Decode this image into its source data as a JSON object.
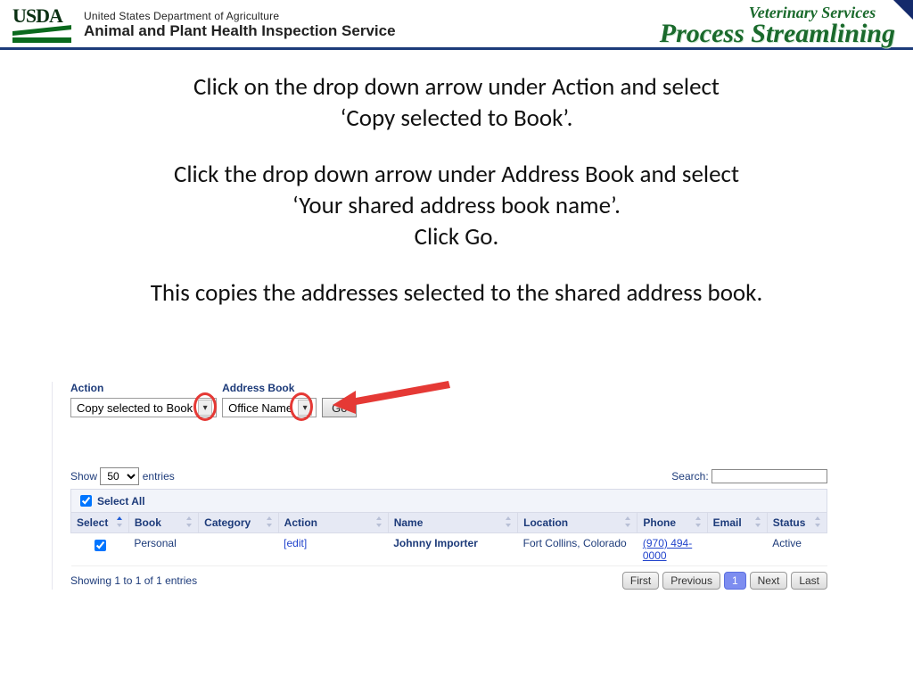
{
  "banner": {
    "usda": "USDA",
    "dept_line1": "United States Department of Agriculture",
    "dept_line2": "Animal and Plant Health Inspection Service",
    "vs": "Veterinary Services",
    "ps": "Process Streamlining"
  },
  "instructions": {
    "p1a": "Click on the drop down arrow under Action and select",
    "p1b": "‘Copy selected to Book’.",
    "p2a": "Click the drop down arrow under Address Book and select",
    "p2b": "‘Your shared address book name’.",
    "p2c": "Click Go.",
    "p3": "This copies the addresses selected to the shared address book."
  },
  "app": {
    "action_label": "Action",
    "action_value": "Copy selected to Book",
    "addrbook_label": "Address Book",
    "addrbook_value": "Office Name",
    "go": "Go",
    "show_label_pre": "Show",
    "show_value": "50",
    "show_label_post": "entries",
    "search_label": "Search:",
    "select_all": "Select All",
    "columns": {
      "select": "Select",
      "book": "Book",
      "category": "Category",
      "action": "Action",
      "name": "Name",
      "location": "Location",
      "phone": "Phone",
      "email": "Email",
      "status": "Status"
    },
    "row": {
      "book": "Personal",
      "category": "",
      "action": "[edit]",
      "name": "Johnny Importer",
      "location": "Fort Collins, Colorado",
      "phone": "(970) 494-0000",
      "email": "",
      "status": "Active"
    },
    "showing": "Showing 1 to 1 of 1 entries",
    "pager": {
      "first": "First",
      "prev": "Previous",
      "page": "1",
      "next": "Next",
      "last": "Last"
    }
  }
}
